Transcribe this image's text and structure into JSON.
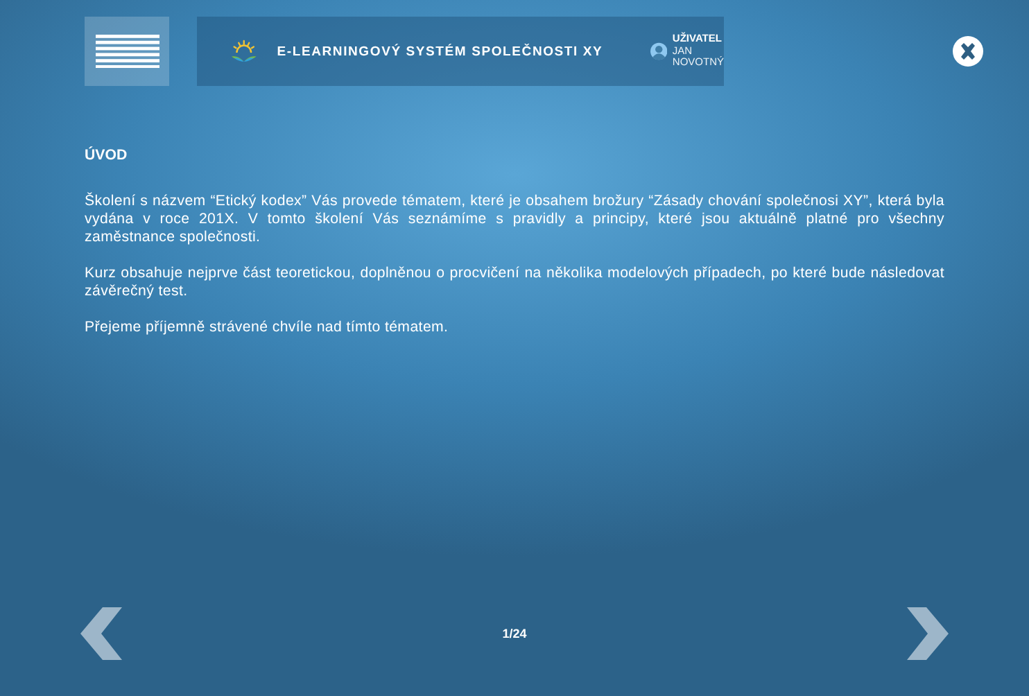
{
  "header": {
    "title": "E-LEARNINGOVÝ SYSTÉM SPOLEČNOSTI XY",
    "user_label": "UŽIVATEL",
    "user_name": "JAN NOVOTNÝ"
  },
  "content": {
    "heading": "ÚVOD",
    "paragraphs": [
      "Školení s názvem “Etický kodex” Vás provede tématem, které je obsahem brožury “Zásady chování společnosi XY”, která byla vydána v roce 201X. V tomto školení Vás seznámíme s pravidly a principy, které jsou aktuálně platné pro všechny zaměstnance společnosti.",
      "Kurz obsahuje nejprve část teoretickou, doplněnou o procvičení na několika modelových případech, po které bude následovat závěrečný test.",
      "Přejeme příjemně strávené chvíle nad tímto tématem."
    ]
  },
  "pager": {
    "page": "1/24"
  }
}
